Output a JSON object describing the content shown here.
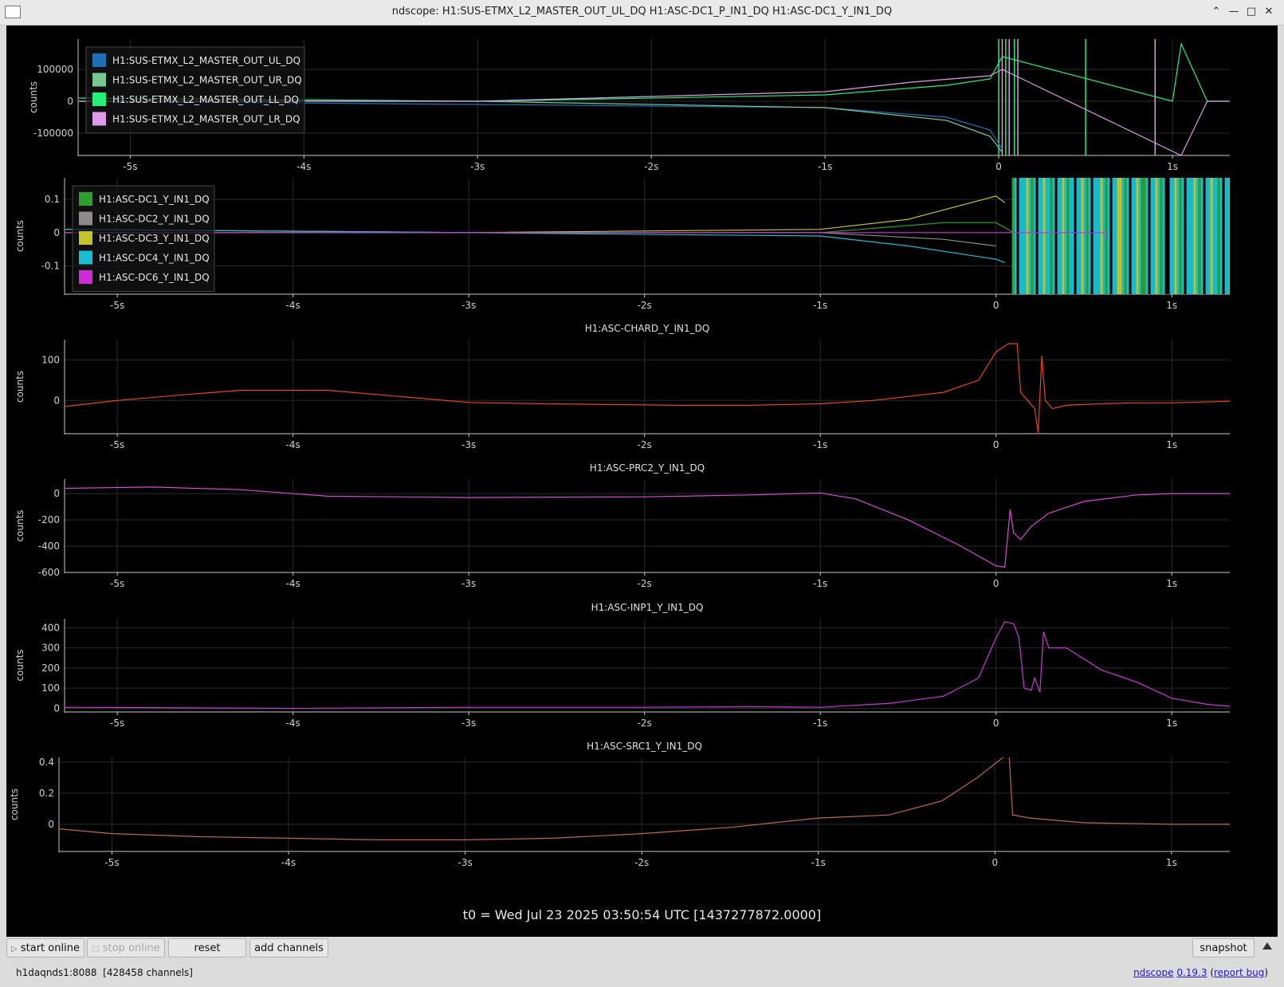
{
  "window": {
    "title": "ndscope: H1:SUS-ETMX_L2_MASTER_OUT_UL_DQ H1:ASC-DC1_P_IN1_DQ H1:ASC-DC1_Y_IN1_DQ"
  },
  "toolbar": {
    "start_online": "start online",
    "stop_online": "stop online",
    "reset": "reset",
    "add_channels": "add channels",
    "snapshot": "snapshot"
  },
  "status": {
    "server": "h1daqnds1:8088",
    "channels": "[428458 channels]"
  },
  "about": {
    "app": "ndscope",
    "version": "0.19.3",
    "report": "report bug",
    "open_paren": " (",
    "close_paren": ")"
  },
  "t0_label": "t0 = Wed Jul 23 2025 03:50:54 UTC [1437277872.0000]",
  "colors": {
    "background": "#000000",
    "axis": "#c8c8c8",
    "grid": "#2a2a2a"
  },
  "chart_data": [
    {
      "type": "line",
      "title": "",
      "ylabel": "counts",
      "x_tick_labels": [
        "-5s",
        "-4s",
        "-3s",
        "-2s",
        "-1s",
        "0",
        "1s"
      ],
      "y_tick_labels": [
        "100000",
        "0",
        "-100000"
      ],
      "xlim": [
        -5.3,
        1.33
      ],
      "ylim": [
        -170000,
        195000
      ],
      "legend": "top-left",
      "series": [
        {
          "name": "H1:SUS-ETMX_L2_MASTER_OUT_UL_DQ",
          "color": "#1f6fb4",
          "x": [
            -5.3,
            -3,
            -1,
            -0.3,
            -0.05,
            0.02
          ],
          "y": [
            0,
            -10000,
            -20000,
            -50000,
            -90000,
            -150000
          ]
        },
        {
          "name": "H1:SUS-ETMX_L2_MASTER_OUT_UR_DQ",
          "color": "#77c893",
          "x": [
            -5.3,
            -3,
            -1,
            -0.3,
            -0.05,
            0.02
          ],
          "y": [
            0,
            0,
            -20000,
            -60000,
            -110000,
            -160000
          ]
        },
        {
          "name": "H1:SUS-ETMX_L2_MASTER_OUT_LL_DQ",
          "color": "#22f07a",
          "x": [
            -5.3,
            -3,
            -1,
            -0.3,
            -0.05,
            0.02,
            1.0,
            1.05,
            1.2,
            1.33
          ],
          "y": [
            10000,
            0,
            20000,
            50000,
            70000,
            140000,
            0,
            180000,
            0,
            0
          ]
        },
        {
          "name": "H1:SUS-ETMX_L2_MASTER_OUT_LR_DQ",
          "color": "#dc9ce8",
          "x": [
            -5.3,
            -3,
            -1,
            -0.5,
            -0.05,
            0.02,
            1.05,
            1.2,
            1.33
          ],
          "y": [
            0,
            0,
            30000,
            60000,
            80000,
            100000,
            -170000,
            0,
            0
          ]
        }
      ]
    },
    {
      "type": "line",
      "title": "",
      "ylabel": "counts",
      "x_tick_labels": [
        "-5s",
        "-4s",
        "-3s",
        "-2s",
        "-1s",
        "0",
        "1s"
      ],
      "y_tick_labels": [
        "0.1",
        "0",
        "-0.1"
      ],
      "xlim": [
        -5.3,
        1.33
      ],
      "ylim": [
        -0.185,
        0.165
      ],
      "legend": "top-left",
      "series": [
        {
          "name": "H1:ASC-DC1_Y_IN1_DQ",
          "color": "#2ca02c",
          "x": [
            -5.3,
            -3,
            -1,
            -0.3,
            0.0,
            0.1
          ],
          "y": [
            0.01,
            0,
            0,
            0.03,
            0.03,
            0.0
          ]
        },
        {
          "name": "H1:ASC-DC2_Y_IN1_DQ",
          "color": "#8c8c8c",
          "x": [
            -5.3,
            -3,
            -1,
            -0.3,
            0.0
          ],
          "y": [
            0.01,
            0,
            0,
            -0.02,
            -0.04
          ]
        },
        {
          "name": "H1:ASC-DC3_Y_IN1_DQ",
          "color": "#c4c42a",
          "x": [
            -5.3,
            -3,
            -1,
            -0.5,
            0.0,
            0.05
          ],
          "y": [
            0,
            0,
            0.01,
            0.04,
            0.11,
            0.09
          ]
        },
        {
          "name": "H1:ASC-DC4_Y_IN1_DQ",
          "color": "#17becf",
          "x": [
            -5.3,
            -3,
            -1,
            -0.5,
            0.0,
            0.05
          ],
          "y": [
            0.01,
            0,
            -0.01,
            -0.04,
            -0.08,
            -0.09
          ]
        },
        {
          "name": "H1:ASC-DC6_Y_IN1_DQ",
          "color": "#d02ad8",
          "x": [
            -5.3,
            -3,
            -1,
            0.1,
            0.62,
            0.63
          ],
          "y": [
            0,
            0,
            0,
            0,
            0,
            -0.02
          ]
        }
      ]
    },
    {
      "type": "line",
      "title": "H1:ASC-CHARD_Y_IN1_DQ",
      "ylabel": "counts",
      "x_tick_labels": [
        "-5s",
        "-4s",
        "-3s",
        "-2s",
        "-1s",
        "0",
        "1s"
      ],
      "y_tick_labels": [
        "100",
        "0"
      ],
      "xlim": [
        -5.3,
        1.33
      ],
      "ylim": [
        -82,
        150
      ],
      "series": [
        {
          "color": "#e8461a",
          "x": [
            -5.3,
            -5.0,
            -4.6,
            -4.3,
            -3.8,
            -3.4,
            -3.0,
            -2.6,
            -2.2,
            -1.8,
            -1.4,
            -1.0,
            -0.7,
            -0.3,
            -0.1,
            0.0,
            0.07,
            0.12,
            0.14,
            0.18,
            0.22,
            0.24,
            0.26,
            0.28,
            0.32,
            0.4,
            0.6,
            0.8,
            1.0,
            1.33
          ],
          "y": [
            -15,
            0,
            15,
            25,
            25,
            10,
            -5,
            -8,
            -10,
            -12,
            -12,
            -8,
            0,
            20,
            50,
            120,
            140,
            140,
            20,
            0,
            -20,
            -80,
            110,
            0,
            -20,
            -12,
            -8,
            -6,
            -6,
            -2
          ]
        }
      ]
    },
    {
      "type": "line",
      "title": "H1:ASC-PRC2_Y_IN1_DQ",
      "ylabel": "counts",
      "x_tick_labels": [
        "-5s",
        "-4s",
        "-3s",
        "-2s",
        "-1s",
        "0",
        "1s"
      ],
      "y_tick_labels": [
        "0",
        "-200",
        "-400",
        "-600"
      ],
      "xlim": [
        -5.3,
        1.33
      ],
      "ylim": [
        -600,
        110
      ],
      "series": [
        {
          "color": "#d44ad6",
          "x": [
            -5.3,
            -4.8,
            -4.3,
            -3.8,
            -3.0,
            -2.0,
            -1.4,
            -1.0,
            -0.8,
            -0.5,
            -0.2,
            0.0,
            0.05,
            0.08,
            0.1,
            0.14,
            0.2,
            0.3,
            0.5,
            0.8,
            1.0,
            1.33
          ],
          "y": [
            40,
            50,
            30,
            -20,
            -30,
            -25,
            -10,
            5,
            -40,
            -200,
            -400,
            -550,
            -560,
            -120,
            -300,
            -350,
            -250,
            -150,
            -60,
            -10,
            0,
            0
          ]
        }
      ]
    },
    {
      "type": "line",
      "title": "H1:ASC-INP1_Y_IN1_DQ",
      "ylabel": "counts",
      "x_tick_labels": [
        "-5s",
        "-4s",
        "-3s",
        "-2s",
        "-1s",
        "0",
        "1s"
      ],
      "y_tick_labels": [
        "400",
        "300",
        "200",
        "100",
        "0"
      ],
      "xlim": [
        -5.3,
        1.33
      ],
      "ylim": [
        -18,
        445
      ],
      "series": [
        {
          "color": "#c83ad6",
          "x": [
            -5.3,
            -4.0,
            -3.0,
            -2.0,
            -1.4,
            -1.0,
            -0.6,
            -0.3,
            -0.1,
            0.0,
            0.05,
            0.1,
            0.13,
            0.16,
            0.2,
            0.22,
            0.25,
            0.27,
            0.3,
            0.4,
            0.6,
            0.8,
            1.0,
            1.2,
            1.33
          ],
          "y": [
            5,
            0,
            5,
            5,
            8,
            5,
            25,
            60,
            150,
            350,
            430,
            420,
            350,
            100,
            90,
            150,
            80,
            380,
            300,
            300,
            190,
            130,
            50,
            20,
            10
          ]
        }
      ]
    },
    {
      "type": "line",
      "title": "H1:ASC-SRC1_Y_IN1_DQ",
      "ylabel": "counts",
      "x_tick_labels": [
        "-5s",
        "-4s",
        "-3s",
        "-2s",
        "-1s",
        "0",
        "1s"
      ],
      "y_tick_labels": [
        "0.4",
        "0.2",
        "0"
      ],
      "xlim": [
        -5.3,
        1.33
      ],
      "ylim": [
        -0.175,
        0.43
      ],
      "series": [
        {
          "color": "#b86a5a",
          "x": [
            -5.3,
            -5.0,
            -4.5,
            -4.0,
            -3.5,
            -3.0,
            -2.5,
            -2.0,
            -1.5,
            -1.0,
            -0.6,
            -0.3,
            -0.1,
            0.08,
            0.1,
            0.2,
            0.5,
            1.0,
            1.33
          ],
          "y": [
            -0.03,
            -0.06,
            -0.08,
            -0.09,
            -0.1,
            -0.1,
            -0.09,
            -0.06,
            -0.02,
            0.04,
            0.06,
            0.15,
            0.3,
            0.46,
            0.06,
            0.04,
            0.01,
            0.0,
            0.0
          ]
        }
      ]
    }
  ]
}
